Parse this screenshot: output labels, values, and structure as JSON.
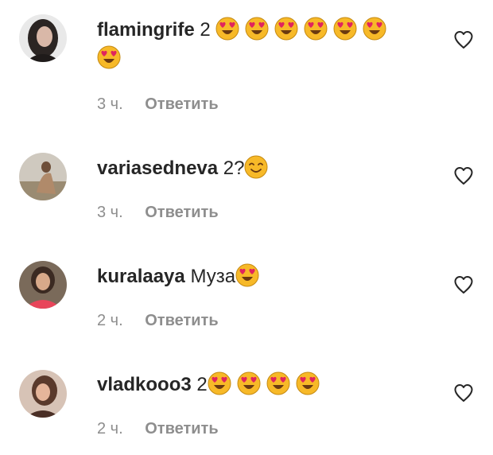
{
  "comments": [
    {
      "username": "flamingrife",
      "text": "2",
      "emoji": [
        "heart-eyes",
        "heart-eyes",
        "heart-eyes",
        "heart-eyes",
        "heart-eyes",
        "heart-eyes",
        "heart-eyes"
      ],
      "time": "3 ч.",
      "reply": "Ответить"
    },
    {
      "username": "variasedneva",
      "text": "2?",
      "emoji": [
        "smiling-face"
      ],
      "time": "3 ч.",
      "reply": "Ответить"
    },
    {
      "username": "kuralaaya",
      "text": "Муза",
      "emoji": [
        "heart-eyes"
      ],
      "time": "2 ч.",
      "reply": "Ответить"
    },
    {
      "username": "vladkooo3",
      "text": "2",
      "emoji": [
        "heart-eyes",
        "heart-eyes",
        "heart-eyes",
        "heart-eyes"
      ],
      "time": "2 ч.",
      "reply": "Ответить"
    }
  ],
  "colors": {
    "text": "#262626",
    "muted": "#8e8e8e",
    "emoji_face": "#f7b928",
    "emoji_heart": "#e0245e"
  }
}
